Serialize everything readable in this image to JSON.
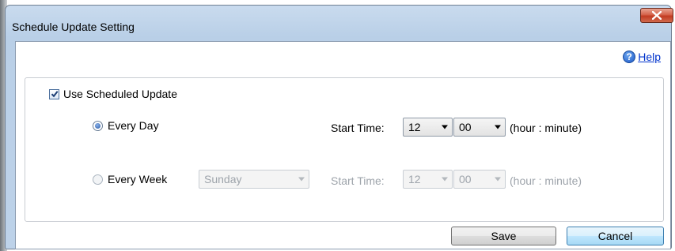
{
  "window": {
    "title": "Schedule Update Setting",
    "close_symbol": "x"
  },
  "help": {
    "label": "Help",
    "icon_symbol": "?"
  },
  "schedule": {
    "use_scheduled_update": {
      "label": "Use Scheduled Update",
      "checked": true
    },
    "every_day": {
      "label": "Every Day",
      "selected": true,
      "start_time_label": "Start Time:",
      "hour": "12",
      "minute": "00",
      "unit": "(hour : minute)"
    },
    "every_week": {
      "label": "Every Week",
      "selected": false,
      "day": "Sunday",
      "start_time_label": "Start Time:",
      "hour": "12",
      "minute": "00",
      "unit": "(hour : minute)"
    }
  },
  "buttons": {
    "save": "Save",
    "cancel": "Cancel"
  },
  "colors": {
    "title_bar": "#c9dbee",
    "close_button": "#c23b22",
    "help_link": "#0033cc",
    "focused_button": "#bee6fd"
  }
}
